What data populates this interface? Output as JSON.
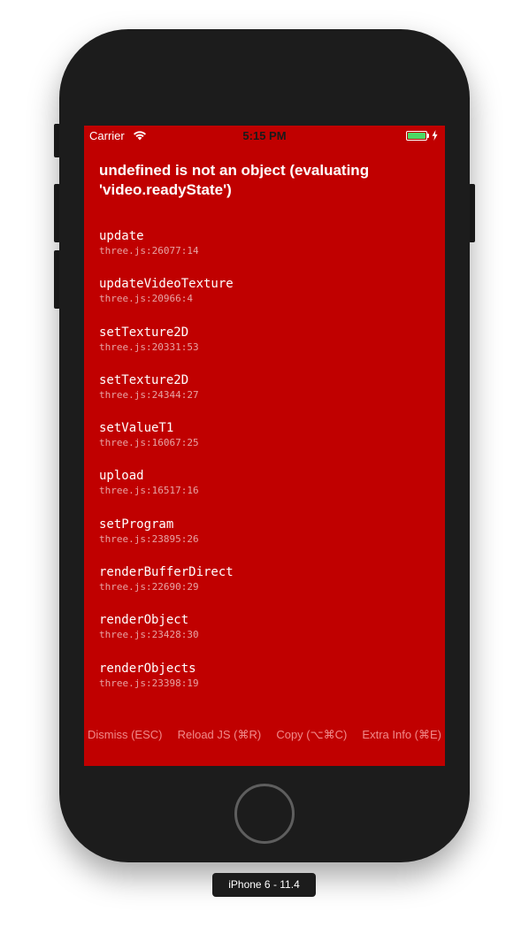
{
  "device": {
    "label": "iPhone 6 - 11.4"
  },
  "status_bar": {
    "carrier": "Carrier",
    "time": "5:15 PM",
    "battery_color": "#4cd964"
  },
  "error": {
    "title": "undefined is not an object (evaluating 'video.readyState')",
    "background_color": "#c00000"
  },
  "stack": [
    {
      "fn": "update",
      "loc": "three.js:26077:14"
    },
    {
      "fn": "updateVideoTexture",
      "loc": "three.js:20966:4"
    },
    {
      "fn": "setTexture2D",
      "loc": "three.js:20331:53"
    },
    {
      "fn": "setTexture2D",
      "loc": "three.js:24344:27"
    },
    {
      "fn": "setValueT1",
      "loc": "three.js:16067:25"
    },
    {
      "fn": "upload",
      "loc": "three.js:16517:16"
    },
    {
      "fn": "setProgram",
      "loc": "three.js:23895:26"
    },
    {
      "fn": "renderBufferDirect",
      "loc": "three.js:22690:29"
    },
    {
      "fn": "renderObject",
      "loc": "three.js:23428:30"
    },
    {
      "fn": "renderObjects",
      "loc": "three.js:23398:19"
    }
  ],
  "toolbar": {
    "dismiss": "Dismiss (ESC)",
    "reload": "Reload JS (⌘R)",
    "copy": "Copy (⌥⌘C)",
    "extra": "Extra Info (⌘E)"
  }
}
